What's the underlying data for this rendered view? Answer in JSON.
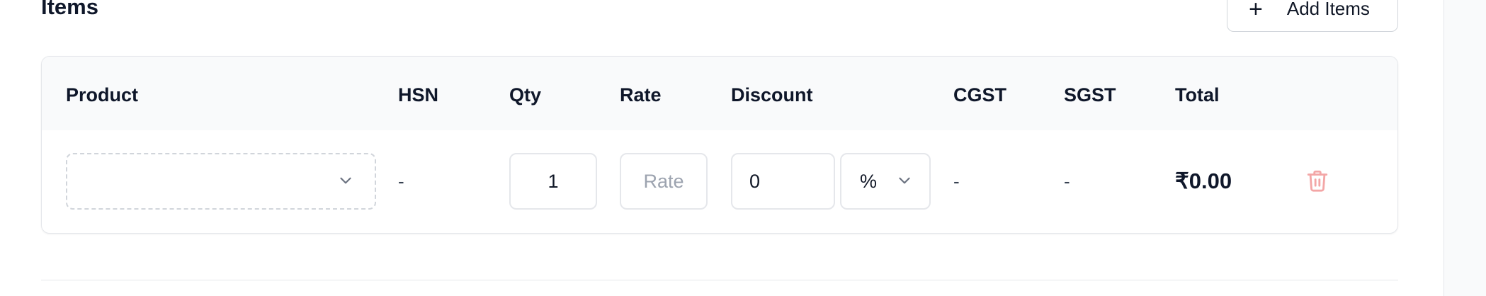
{
  "section": {
    "title": "Items",
    "add_button_label": "Add Items"
  },
  "table": {
    "headers": {
      "product": "Product",
      "hsn": "HSN",
      "qty": "Qty",
      "rate": "Rate",
      "discount": "Discount",
      "cgst": "CGST",
      "sgst": "SGST",
      "total": "Total"
    },
    "rows": [
      {
        "product_value": "",
        "hsn": "-",
        "qty": "1",
        "rate_placeholder": "Rate",
        "discount_value": "0",
        "discount_type": "%",
        "cgst": "-",
        "sgst": "-",
        "total": "₹0.00"
      }
    ]
  },
  "icons": {
    "add": "plus-icon",
    "dropdown": "chevron-down-icon",
    "delete": "trash-icon"
  },
  "colors": {
    "delete_icon": "#f3a6a6",
    "header_bg": "#f9fafb",
    "border": "#e5e7eb"
  }
}
